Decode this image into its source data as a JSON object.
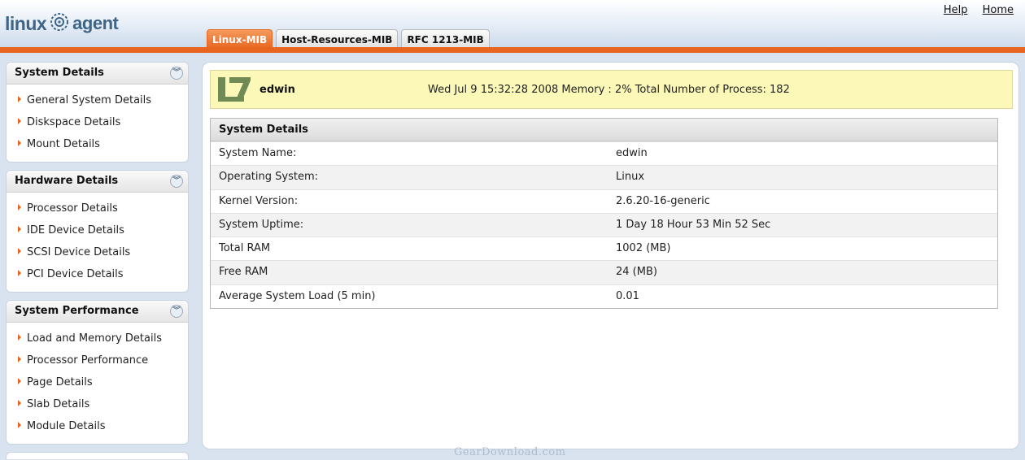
{
  "header": {
    "logo_left": "linux",
    "logo_right": "agent",
    "links": [
      "Help",
      "Home"
    ],
    "tabs": [
      {
        "label": "Linux-MIB",
        "active": true
      },
      {
        "label": "Host-Resources-MIB",
        "active": false
      },
      {
        "label": "RFC 1213-MIB",
        "active": false
      }
    ],
    "accent_color": "#e8651f"
  },
  "sidebar": {
    "panels": [
      {
        "title": "System Details",
        "items": [
          "General System Details",
          "Diskspace Details",
          "Mount Details"
        ]
      },
      {
        "title": "Hardware Details",
        "items": [
          "Processor Details",
          "IDE Device Details",
          "SCSI Device Details",
          "PCI Device Details"
        ]
      },
      {
        "title": "System Performance",
        "items": [
          "Load and Memory Details",
          "Processor Performance",
          "Page Details",
          "Slab Details",
          "Module Details"
        ]
      }
    ],
    "collapse_icon": "chevron-double-down-icon"
  },
  "main": {
    "hostname": "edwin",
    "status": "Wed Jul 9 15:32:28 2008 Memory : 2% Total Number of Process: 182",
    "details_title": "System Details",
    "rows": [
      {
        "label": "System Name:",
        "value": "edwin"
      },
      {
        "label": "Operating System:",
        "value": "Linux"
      },
      {
        "label": "Kernel Version:",
        "value": "2.6.20-16-generic"
      },
      {
        "label": "System Uptime:",
        "value": "1 Day 18 Hour 53 Min 52 Sec"
      },
      {
        "label": "Total RAM",
        "value": "1002 (MB)"
      },
      {
        "label": "Free RAM",
        "value": "24 (MB)"
      },
      {
        "label": "Average System Load (5 min)",
        "value": "0.01"
      }
    ]
  },
  "watermark": "GearDownload.com"
}
